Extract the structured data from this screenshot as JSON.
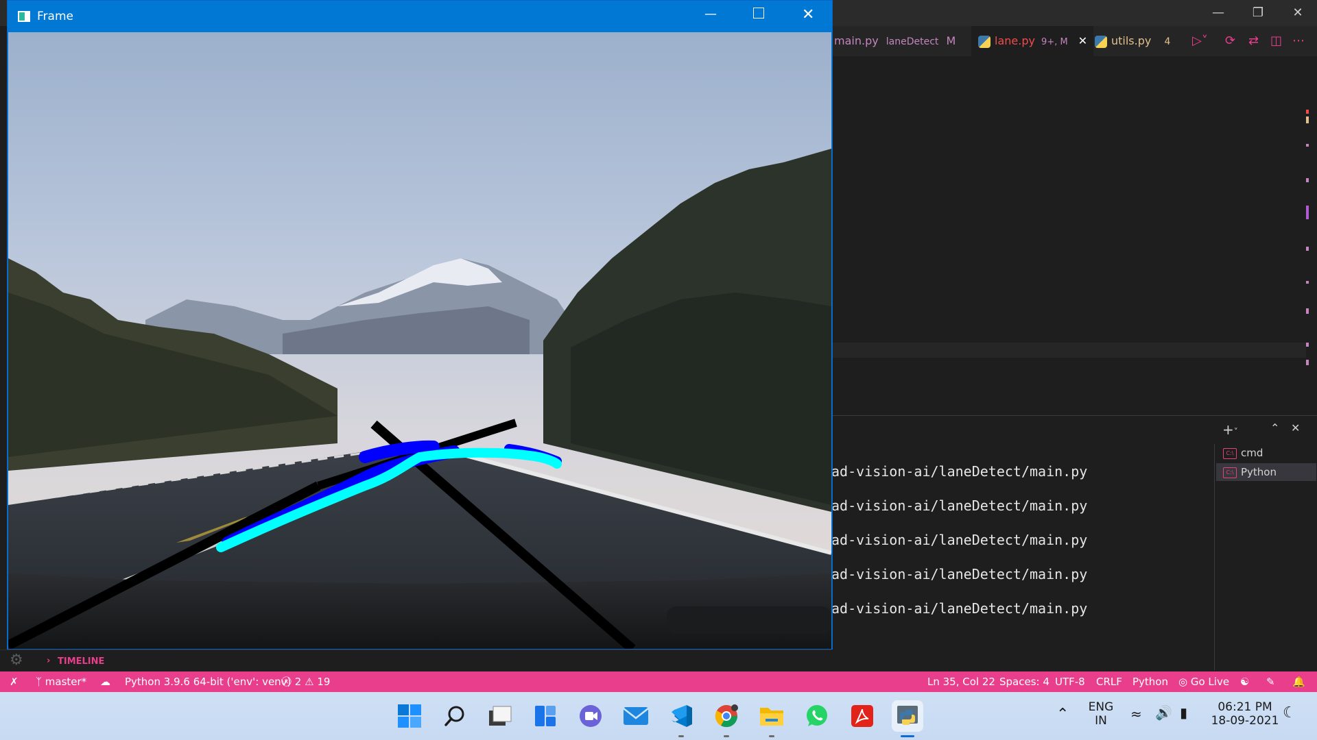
{
  "vscode": {
    "tabs": [
      {
        "name": "main.py",
        "detail": "laneDetect",
        "badge": "M"
      },
      {
        "name": "lane.py",
        "detail": "9+, M",
        "badge": ""
      },
      {
        "name": "utils.py",
        "detail": "4",
        "badge": ""
      }
    ],
    "terminal_lines": [
      "ad-vision-ai/laneDetect/main.py",
      "ad-vision-ai/laneDetect/main.py",
      "ad-vision-ai/laneDetect/main.py",
      "ad-vision-ai/laneDetect/main.py",
      "ad-vision-ai/laneDetect/main.py"
    ],
    "terminal_sessions": [
      "cmd",
      "Python"
    ],
    "timeline_label": "TIMELINE"
  },
  "statusbar": {
    "branch": "master*",
    "interpreter": "Python 3.9.6 64-bit ('env': venv)",
    "errors": "2",
    "warnings": "19",
    "cursor": "Ln 35, Col 22",
    "spaces": "Spaces: 4",
    "encoding": "UTF-8",
    "eol": "CRLF",
    "language": "Python",
    "golive": "Go Live",
    "color": "#e83e8c"
  },
  "frame": {
    "title": "Frame"
  },
  "taskbar": {
    "apps": [
      "windows-start-icon",
      "search-icon",
      "task-view-icon",
      "widgets-icon",
      "teams-chat-icon",
      "mail-icon",
      "vscode-icon",
      "chrome-icon",
      "file-explorer-icon",
      "whatsapp-icon",
      "acrobat-icon",
      "python-icon"
    ],
    "lang_top": "ENG",
    "lang_bottom": "IN",
    "time": "06:21 PM",
    "date": "18-09-2021"
  }
}
